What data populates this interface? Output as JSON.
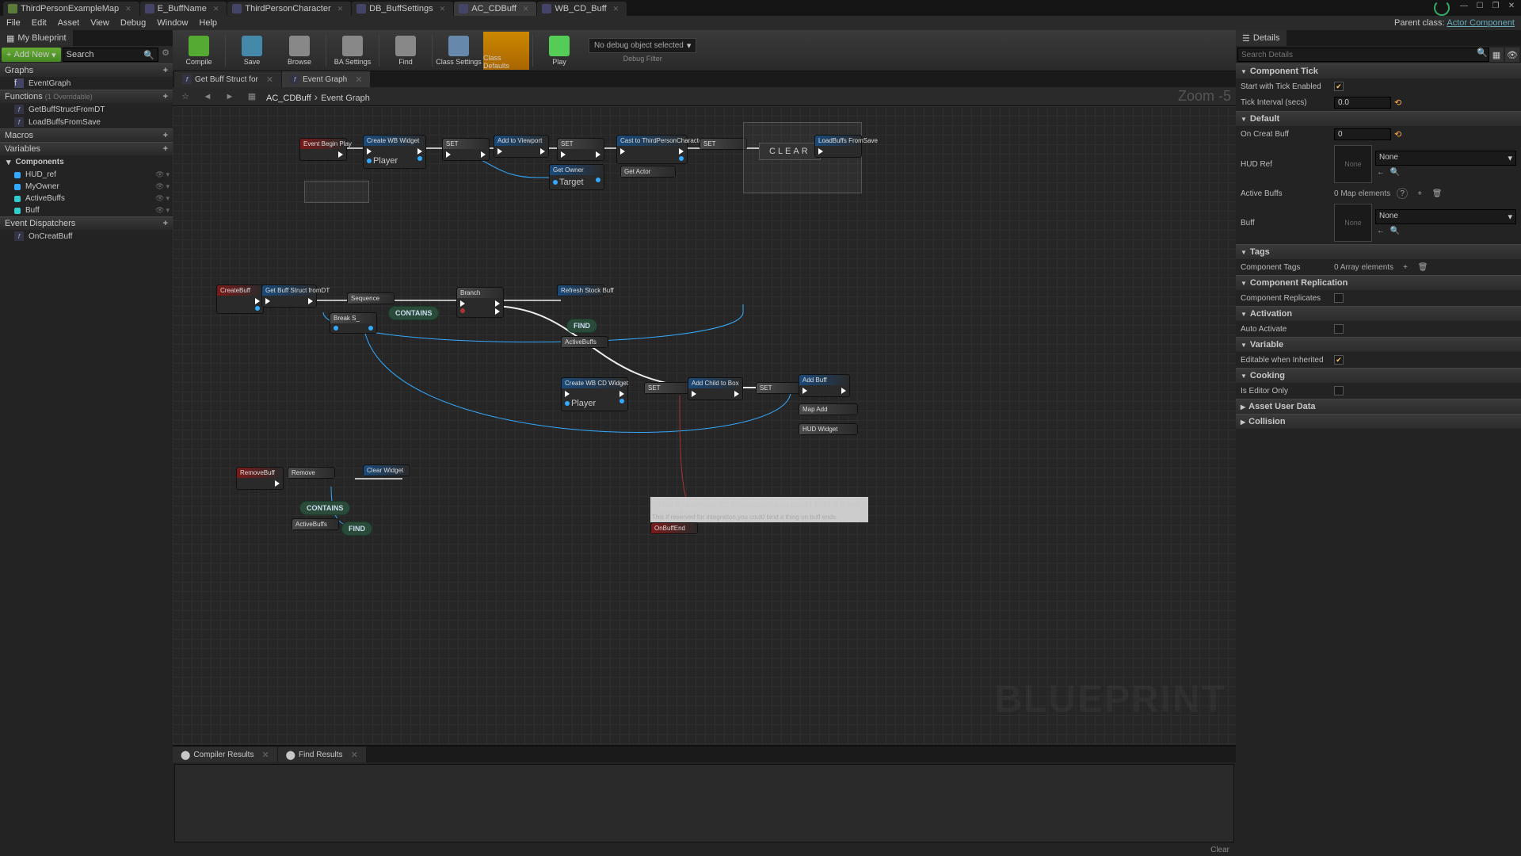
{
  "topTabs": [
    {
      "label": "ThirdPersonExampleMap",
      "icon": "level"
    },
    {
      "label": "E_BuffName",
      "icon": "bp"
    },
    {
      "label": "ThirdPersonCharacter",
      "icon": "bp"
    },
    {
      "label": "DB_BuffSettings",
      "icon": "bp"
    },
    {
      "label": "AC_CDBuff",
      "icon": "bp",
      "active": true
    },
    {
      "label": "WB_CD_Buff",
      "icon": "bp"
    }
  ],
  "menuBar": [
    "File",
    "Edit",
    "Asset",
    "View",
    "Debug",
    "Window",
    "Help"
  ],
  "parentClass": {
    "prefix": "Parent class:",
    "link": "Actor Component"
  },
  "myBlueprint": {
    "tab": "My Blueprint",
    "addNew": "Add New",
    "searchPlaceholder": "Search",
    "sections": {
      "graphs": {
        "title": "Graphs",
        "items": [
          {
            "label": "EventGraph"
          }
        ]
      },
      "functions": {
        "title": "Functions",
        "sub": "(1 Overridable)",
        "items": [
          {
            "label": "GetBuffStructFromDT"
          },
          {
            "label": "LoadBuffsFromSave"
          }
        ]
      },
      "macros": {
        "title": "Macros",
        "items": []
      },
      "variables": {
        "title": "Variables",
        "items": [
          {
            "label": "Components",
            "type": "cat"
          },
          {
            "label": "HUD_ref",
            "type": "blue"
          },
          {
            "label": "MyOwner",
            "type": "blue"
          },
          {
            "label": "ActiveBuffs",
            "type": "cyan"
          },
          {
            "label": "Buff",
            "type": "cyan"
          }
        ]
      },
      "dispatchers": {
        "title": "Event Dispatchers",
        "items": [
          {
            "label": "OnCreatBuff"
          }
        ]
      }
    }
  },
  "toolbar": {
    "buttons": [
      {
        "label": "Compile",
        "color": "#5a3"
      },
      {
        "label": "Save",
        "color": "#48a"
      },
      {
        "label": "Browse",
        "color": "#888"
      },
      {
        "label": "BA Settings",
        "color": "#888"
      },
      {
        "label": "Find",
        "color": "#888"
      },
      {
        "label": "Class Settings",
        "color": "#68a"
      },
      {
        "label": "Class Defaults",
        "color": "#c80",
        "active": true
      },
      {
        "label": "Play",
        "color": "#5c5"
      }
    ],
    "debugCombo": "No debug object selected",
    "debugFilter": "Debug Filter"
  },
  "graphTabs": [
    {
      "label": "Get Buff Struct for"
    },
    {
      "label": "Event Graph",
      "active": true
    }
  ],
  "breadcrumb": {
    "asset": "AC_CDBuff",
    "graph": "Event Graph",
    "zoom": "Zoom -5"
  },
  "graph": {
    "watermark": "BLUEPRINT",
    "contains": "CONTAINS",
    "find": "FIND",
    "clear": "CLEAR",
    "hintText": "This if reserved for integration,you could bind a thing on buff en",
    "hintSub": "This if reserved for integration,you could bind a thing on buff ends."
  },
  "resultsTabs": [
    {
      "label": "Compiler Results"
    },
    {
      "label": "Find Results"
    }
  ],
  "resultsClear": "Clear",
  "details": {
    "tab": "Details",
    "searchPlaceholder": "Search Details",
    "categories": [
      {
        "title": "Component Tick",
        "rows": [
          {
            "label": "Start with Tick Enabled",
            "type": "check",
            "checked": true
          },
          {
            "label": "Tick Interval (secs)",
            "type": "num",
            "value": "0.0"
          }
        ]
      },
      {
        "title": "Default",
        "rows": [
          {
            "label": "On Creat Buff",
            "type": "num",
            "value": "0"
          },
          {
            "label": "HUD Ref",
            "type": "asset",
            "value": "None"
          },
          {
            "label": "Active Buffs",
            "type": "map",
            "value": "0 Map elements"
          },
          {
            "label": "Buff",
            "type": "asset",
            "value": "None"
          }
        ]
      },
      {
        "title": "Tags",
        "rows": [
          {
            "label": "Component Tags",
            "type": "array",
            "value": "0 Array elements"
          }
        ]
      },
      {
        "title": "Component Replication",
        "rows": [
          {
            "label": "Component Replicates",
            "type": "check",
            "checked": false
          }
        ]
      },
      {
        "title": "Activation",
        "rows": [
          {
            "label": "Auto Activate",
            "type": "check",
            "checked": false
          }
        ]
      },
      {
        "title": "Variable",
        "rows": [
          {
            "label": "Editable when Inherited",
            "type": "check",
            "checked": true
          }
        ]
      },
      {
        "title": "Cooking",
        "rows": [
          {
            "label": "Is Editor Only",
            "type": "check",
            "checked": false
          }
        ]
      },
      {
        "title": "Asset User Data",
        "collapsed": true
      },
      {
        "title": "Collision",
        "collapsed": true
      }
    ]
  }
}
